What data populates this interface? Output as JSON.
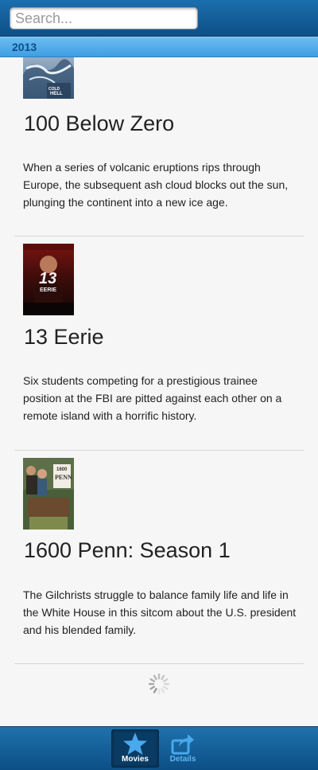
{
  "search": {
    "placeholder": "Search..."
  },
  "section": {
    "label": "2013"
  },
  "movies": [
    {
      "title": "100 Below Zero",
      "description": "When a series of volcanic eruptions rips through Europe, the subsequent ash cloud blocks out the sun, plunging the continent into a new ice age.",
      "poster_text": [
        "COLD",
        "HELL"
      ]
    },
    {
      "title": "13 Eerie",
      "description": "Six students competing for a prestigious trainee position at the FBI are pitted against each other on a remote island with a horrific history.",
      "poster_text": [
        "13",
        "EERIE"
      ]
    },
    {
      "title": "1600 Penn: Season 1",
      "description": "The Gilchrists struggle to balance family life and life in the White House in this sitcom about the U.S. president and his blended family.",
      "poster_text": [
        "1600",
        "PENN"
      ]
    }
  ],
  "tabs": [
    {
      "label": "Movies",
      "icon": "star-icon",
      "active": true
    },
    {
      "label": "Details",
      "icon": "share-icon",
      "active": false
    }
  ],
  "colors": {
    "topbar": "#0e4f86",
    "section_header": "#3f9ee3",
    "section_text": "#0c4f86",
    "tab_active_bg": "#0a3b63",
    "tab_icon": "#4aa8ec"
  }
}
